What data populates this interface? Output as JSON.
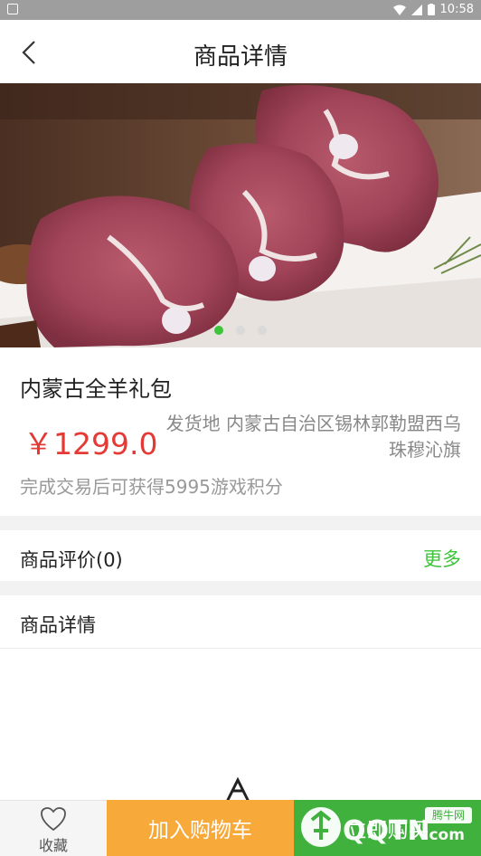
{
  "status_bar": {
    "time": "10:58"
  },
  "header": {
    "title": "商品详情"
  },
  "carousel": {
    "slide_count": 3,
    "active_index": 0
  },
  "product": {
    "name": "内蒙古全羊礼包",
    "price": "￥1299.0",
    "shipping": "发货地 内蒙古自治区锡林郭勒盟西乌珠穆沁旗",
    "points_note": "完成交易后可获得5995游戏积分"
  },
  "reviews": {
    "label": "商品评价(0)",
    "more": "更多"
  },
  "details": {
    "label": "商品详情"
  },
  "bottom_bar": {
    "favorite": "收藏",
    "add_to_cart": "加入购物车",
    "buy_now": "立即购买"
  },
  "watermark": {
    "text": "QQTN.com",
    "badge": "腾牛网"
  },
  "colors": {
    "accent_green": "#3ec43b",
    "price_red": "#e53935",
    "cart_orange": "#f7a93a",
    "buy_green": "#3fb13c"
  }
}
